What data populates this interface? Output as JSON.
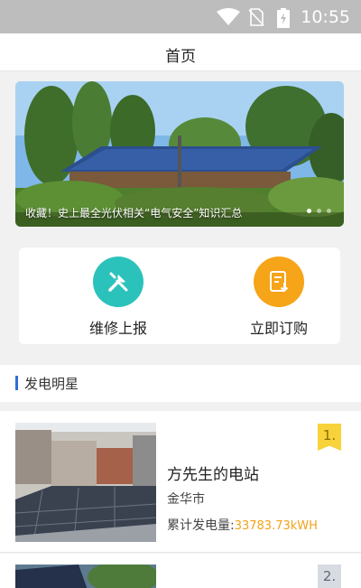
{
  "status_bar": {
    "time": "10:55"
  },
  "header": {
    "title": "首页"
  },
  "banner": {
    "caption": "收藏！史上最全光伏相关“电气安全”知识汇总",
    "slides": 3,
    "active": 1
  },
  "quick_actions": [
    {
      "label": "维修上报",
      "icon": "tools-icon",
      "color": "#2cc2bc"
    },
    {
      "label": "立即订购",
      "icon": "order-form-icon",
      "color": "#f6a418"
    }
  ],
  "section": {
    "title": "发电明星"
  },
  "stations": [
    {
      "rank": "1.",
      "name": "方先生的电站",
      "city": "金华市",
      "energy_label": "累计发电量:",
      "energy_value": "33783.73kWH"
    },
    {
      "rank": "2."
    }
  ]
}
